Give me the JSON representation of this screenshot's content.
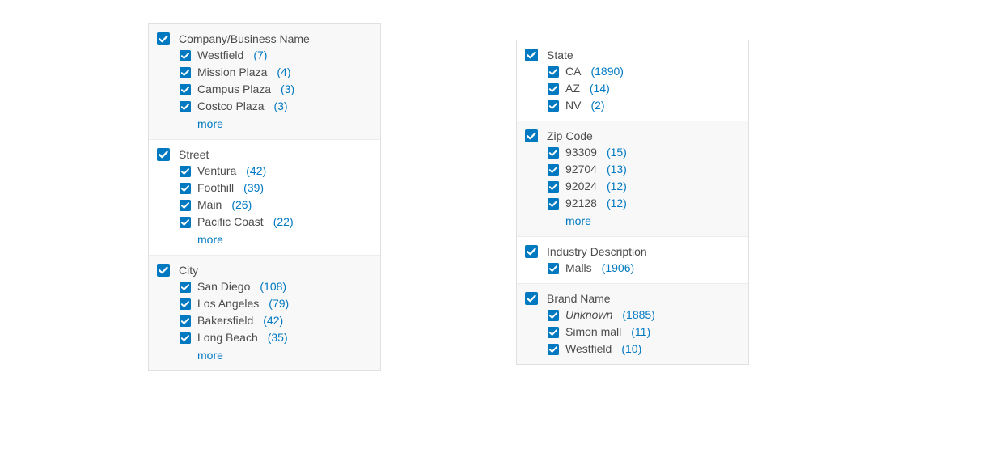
{
  "colors": {
    "accent": "#0079c1",
    "text": "#4c4c4c"
  },
  "more_label": "more",
  "left": [
    {
      "title": "Company/Business Name",
      "shade": true,
      "more": true,
      "items": [
        {
          "label": "Westfield",
          "count": "(7)"
        },
        {
          "label": "Mission Plaza",
          "count": "(4)"
        },
        {
          "label": "Campus Plaza",
          "count": "(3)"
        },
        {
          "label": "Costco Plaza",
          "count": "(3)"
        }
      ]
    },
    {
      "title": "Street",
      "shade": false,
      "more": true,
      "items": [
        {
          "label": "Ventura",
          "count": "(42)"
        },
        {
          "label": "Foothill",
          "count": "(39)"
        },
        {
          "label": "Main",
          "count": "(26)"
        },
        {
          "label": "Pacific Coast",
          "count": "(22)"
        }
      ]
    },
    {
      "title": "City",
      "shade": true,
      "more": true,
      "items": [
        {
          "label": "San Diego",
          "count": "(108)"
        },
        {
          "label": "Los Angeles",
          "count": "(79)"
        },
        {
          "label": "Bakersfield",
          "count": "(42)"
        },
        {
          "label": "Long Beach",
          "count": "(35)"
        }
      ]
    }
  ],
  "right": [
    {
      "title": "State",
      "shade": false,
      "more": false,
      "items": [
        {
          "label": "CA",
          "count": "(1890)"
        },
        {
          "label": "AZ",
          "count": "(14)"
        },
        {
          "label": "NV",
          "count": "(2)"
        }
      ]
    },
    {
      "title": "Zip Code",
      "shade": true,
      "more": true,
      "items": [
        {
          "label": "93309",
          "count": "(15)"
        },
        {
          "label": "92704",
          "count": "(13)"
        },
        {
          "label": "92024",
          "count": "(12)"
        },
        {
          "label": "92128",
          "count": "(12)"
        }
      ]
    },
    {
      "title": "Industry Description",
      "shade": false,
      "more": false,
      "items": [
        {
          "label": "Malls",
          "count": "(1906)"
        }
      ]
    },
    {
      "title": "Brand Name",
      "shade": true,
      "more": false,
      "items": [
        {
          "label": "Unknown",
          "count": "(1885)",
          "italic": true
        },
        {
          "label": "Simon mall",
          "count": "(11)"
        },
        {
          "label": "Westfield",
          "count": "(10)"
        }
      ]
    }
  ]
}
